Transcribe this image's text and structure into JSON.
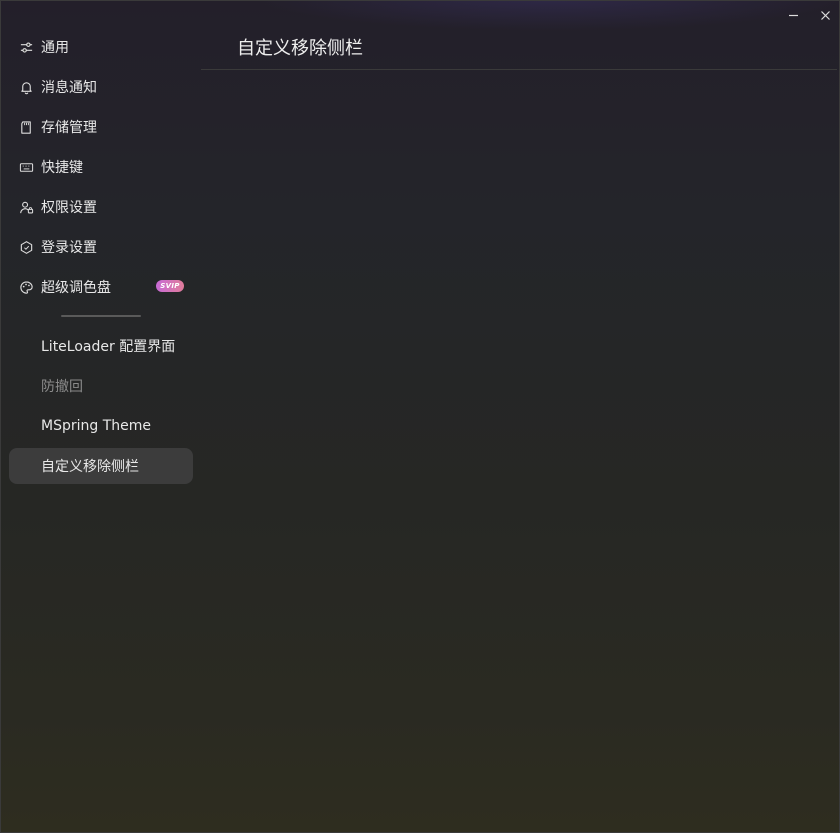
{
  "window_controls": {
    "minimize_icon": "minimize-icon",
    "close_icon": "close-icon"
  },
  "sidebar": {
    "items": [
      {
        "label": "通用",
        "icon": "sliders-icon"
      },
      {
        "label": "消息通知",
        "icon": "bell-icon"
      },
      {
        "label": "存储管理",
        "icon": "storage-card-icon"
      },
      {
        "label": "快捷键",
        "icon": "keyboard-icon"
      },
      {
        "label": "权限设置",
        "icon": "user-lock-icon"
      },
      {
        "label": "登录设置",
        "icon": "hexagon-icon"
      },
      {
        "label": "超级调色盘",
        "icon": "palette-icon",
        "badge": "SVIP"
      }
    ],
    "plugins": [
      {
        "label": "LiteLoader 配置界面",
        "state": "normal"
      },
      {
        "label": "防撤回",
        "state": "dim"
      },
      {
        "label": "MSpring Theme",
        "state": "normal"
      },
      {
        "label": "自定义移除侧栏",
        "state": "active"
      }
    ]
  },
  "main": {
    "title": "自定义移除侧栏"
  },
  "colors": {
    "active_item_bg": "#3c3c3c",
    "badge_gradient_start": "#c86bd6",
    "badge_gradient_end": "#e07c9a",
    "text": "#e8e8e8",
    "dim_text": "#8a8a8a"
  }
}
